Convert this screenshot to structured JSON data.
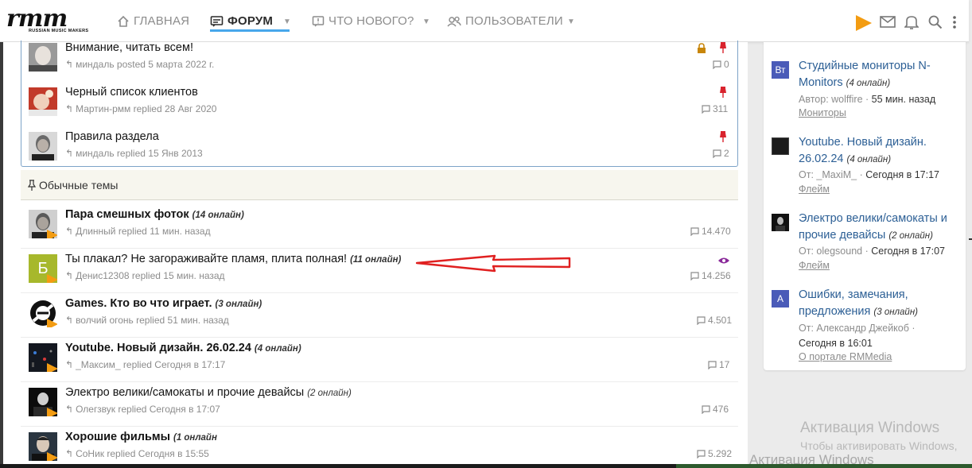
{
  "nav": {
    "logo_main": "rmm",
    "logo_sub": "RUSSIAN MUSIC MAKERS",
    "tabs": [
      {
        "label": "ГЛАВНАЯ",
        "icon": "home-icon"
      },
      {
        "label": "ФОРУМ",
        "icon": "forum-icon",
        "active": true
      },
      {
        "label": "ЧТО НОВОГО?",
        "icon": "whats-new-icon"
      },
      {
        "label": "ПОЛЬЗОВАТЕЛИ",
        "icon": "users-icon"
      }
    ],
    "right_icons": [
      "play-icon",
      "mail-icon",
      "bell-icon",
      "search-icon",
      "more-icon"
    ],
    "accent": "#f39c12"
  },
  "sticky_threads": [
    {
      "title": "Внимание, читать всем!",
      "user": "миндаль",
      "action": "posted",
      "date": "5 марта 2022 г.",
      "replies": "0",
      "locked": true,
      "pinned": true
    },
    {
      "title": "Черный список клиентов",
      "user": "Мартин-рмм",
      "action": "replied",
      "date": "28 Авг 2020",
      "replies": "311",
      "pinned": true
    },
    {
      "title": "Правила раздела",
      "user": "миндаль",
      "action": "replied",
      "date": "15 Янв 2013",
      "replies": "2",
      "pinned": true
    }
  ],
  "section": {
    "label": "Обычные темы"
  },
  "threads": [
    {
      "title": "Пара смешных фоток",
      "online": "(14 онлайн)",
      "user": "Длинный",
      "action": "replied",
      "date": "11 мин. назад",
      "replies": "14.470",
      "bold": true
    },
    {
      "title": "Ты плакал? Не загораживайте пламя, плита полная!",
      "online": "(11 онлайн)",
      "user": "Денис12308",
      "action": "replied",
      "date": "15 мин. назад",
      "replies": "14.256",
      "bold": false,
      "avatar_letter": "Б",
      "watched": true
    },
    {
      "title": "Games. Кто во что играет.",
      "online": "(3 онлайн)",
      "user": "волчий огонь",
      "action": "replied",
      "date": "51 мин. назад",
      "replies": "4.501",
      "bold": true
    },
    {
      "title": "Youtube. Новый дизайн. 26.02.24",
      "online": "(4 онлайн)",
      "user": "_Максим_",
      "action": "replied",
      "date": "Сегодня в 17:17",
      "replies": "17",
      "bold": true
    },
    {
      "title": "Электро велики/самокаты и прочие девайсы",
      "online": "(2 онлайн)",
      "user": "Олегзвук",
      "action": "replied",
      "date": "Сегодня в 17:07",
      "replies": "476",
      "bold": false
    },
    {
      "title": "Хорошие фильмы",
      "online": "(1 онлайн",
      "user": "СоНик",
      "action": "replied",
      "date": "Сегодня в 15:55",
      "replies": "5.292",
      "bold": true
    }
  ],
  "sidebar": {
    "items": [
      {
        "avatar": "Вт",
        "avatar_color": "#4a5bb8",
        "title": "Студийные мониторы N-Monitors",
        "online": "(4 онлайн)",
        "meta_prefix": "Автор:",
        "user": "wolffire",
        "time": "55 мин. назад",
        "category": "Мониторы"
      },
      {
        "avatar": "",
        "avatar_color": "#1b1b1b",
        "title": "Youtube. Новый дизайн. 26.02.24",
        "online": "(4 онлайн)",
        "meta_prefix": "От:",
        "user": "_MaxiM_",
        "time": "Сегодня в 17:17",
        "category": "Флейм"
      },
      {
        "avatar": "",
        "avatar_color": "#111111",
        "title": "Электро велики/самокаты и прочие девайсы",
        "online": "(2 онлайн)",
        "meta_prefix": "От:",
        "user": "olegsound",
        "time": "Сегодня в 17:07",
        "category": "Флейм"
      },
      {
        "avatar": "А",
        "avatar_color": "#4a5bb8",
        "title": "Ошибки, замечания, предложения",
        "online": "(3 онлайн)",
        "meta_prefix": "От:",
        "user": "Александр Джейкоб",
        "time": "Сегодня в 16:01",
        "category": "О портале RMMedia"
      }
    ]
  },
  "watermark": {
    "line1": "Активация Windows",
    "line2": "Чтобы активировать Windows,",
    "line3": "Активация Windows"
  }
}
